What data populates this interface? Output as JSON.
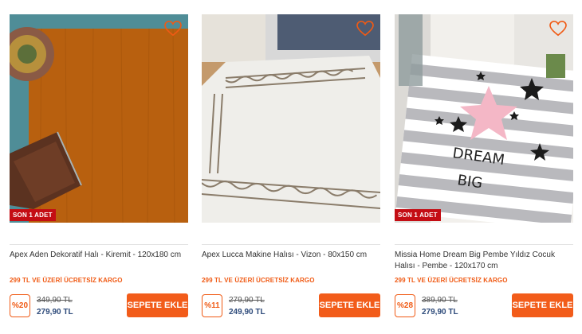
{
  "products": [
    {
      "title": "Apex Aden Dekoratif Halı - Kiremit - 120x180 cm",
      "badge": "SON 1 ADET",
      "cargo": "299 TL VE ÜZERİ ÜCRETSİZ KARGO",
      "discount": "%20",
      "old_price": "349,90 TL",
      "new_price": "279,90 TL",
      "cart_label": "SEPETE EKLE",
      "icon": "heart-outline-icon"
    },
    {
      "title": "Apex Lucca Makine Halısı - Vizon - 80x150 cm",
      "cargo": "299 TL VE ÜZERİ ÜCRETSİZ KARGO",
      "discount": "%11",
      "old_price": "279,90 TL",
      "new_price": "249,90 TL",
      "cart_label": "SEPETE EKLE",
      "icon": "heart-outline-icon"
    },
    {
      "title": "Missia Home Dream Big Pembe Yıldız Cocuk Halısı - Pembe - 120x170 cm",
      "badge": "SON 1 ADET",
      "cargo": "299 TL VE ÜZERİ ÜCRETSİZ KARGO",
      "discount": "%28",
      "old_price": "389,90 TL",
      "new_price": "279,90 TL",
      "cart_label": "SEPETE EKLE",
      "icon": "heart-outline-icon",
      "rug_text": [
        "DREAM",
        "BIG"
      ]
    }
  ],
  "colors": {
    "accent": "#f25c1a",
    "badge": "#c40d14",
    "price": "#2d4a7a"
  }
}
